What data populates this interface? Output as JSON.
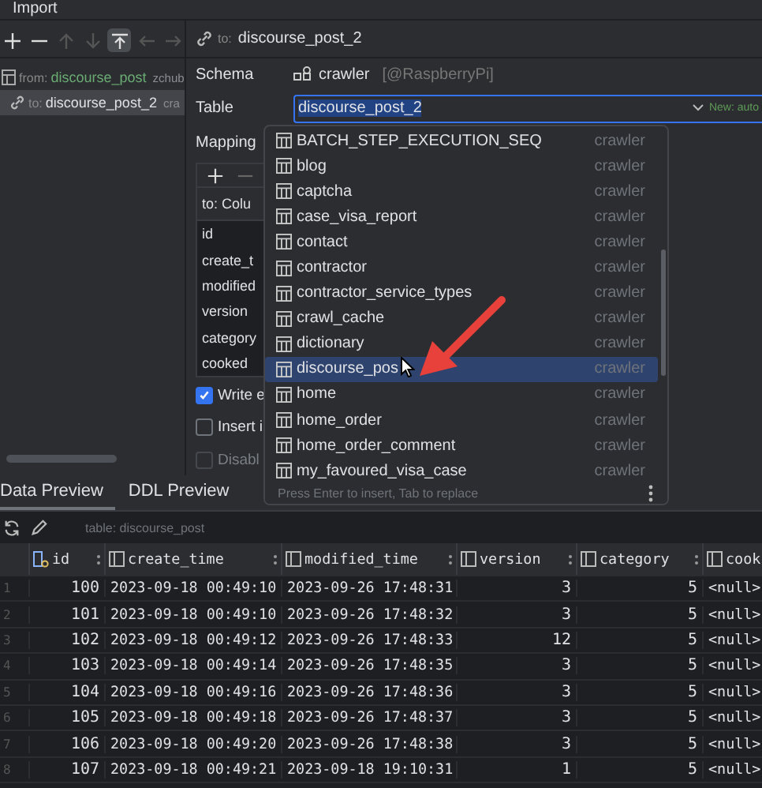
{
  "window": {
    "title": "Import"
  },
  "toolbar_buttons": [
    {
      "kind": "add",
      "disabled": false,
      "selected": false
    },
    {
      "kind": "remove",
      "disabled": false,
      "selected": false
    },
    {
      "kind": "up",
      "disabled": true,
      "selected": false
    },
    {
      "kind": "down",
      "disabled": true,
      "selected": false
    },
    {
      "kind": "pin",
      "disabled": false,
      "selected": true
    },
    {
      "kind": "back",
      "disabled": true,
      "selected": false
    },
    {
      "kind": "forward",
      "disabled": true,
      "selected": false
    }
  ],
  "sources": [
    {
      "prefix": "from:",
      "name": "discourse_post",
      "extra": "zchub",
      "selected": false,
      "children": [
        {
          "prefix": "to:",
          "name": "discourse_post_2",
          "extra": "cra",
          "selected": true
        }
      ]
    }
  ],
  "target": {
    "header_prefix": "to:",
    "header_name": "discourse_post_2",
    "schema_label": "Schema",
    "schema": "crawler",
    "schema_host": "[@RaspberryPi]",
    "table_label": "Table",
    "table_value": "discourse_post_2",
    "table_text_selected": true,
    "table_badge": "New: auto",
    "mapping_label": "Mapping",
    "mapping_header": "to: Colu",
    "mapping_rows": [
      "id",
      "create_t",
      "modified",
      "version",
      "category",
      "cooked"
    ],
    "options": [
      {
        "label": "Write e",
        "checked": true,
        "disabled": false
      },
      {
        "label": "Insert i",
        "checked": false,
        "disabled": false
      },
      {
        "label": "Disabl",
        "checked": false,
        "disabled": true
      }
    ]
  },
  "popup": {
    "items": [
      {
        "name": "BATCH_STEP_EXECUTION_SEQ",
        "schema": "crawler",
        "selected": false
      },
      {
        "name": "blog",
        "schema": "crawler",
        "selected": false
      },
      {
        "name": "captcha",
        "schema": "crawler",
        "selected": false
      },
      {
        "name": "case_visa_report",
        "schema": "crawler",
        "selected": false
      },
      {
        "name": "contact",
        "schema": "crawler",
        "selected": false
      },
      {
        "name": "contractor",
        "schema": "crawler",
        "selected": false
      },
      {
        "name": "contractor_service_types",
        "schema": "crawler",
        "selected": false
      },
      {
        "name": "crawl_cache",
        "schema": "crawler",
        "selected": false
      },
      {
        "name": "dictionary",
        "schema": "crawler",
        "selected": false
      },
      {
        "name": "discourse_pos",
        "schema": "crawler",
        "selected": true
      },
      {
        "name": "home",
        "schema": "crawler",
        "selected": false
      },
      {
        "name": "home_order",
        "schema": "crawler",
        "selected": false
      },
      {
        "name": "home_order_comment",
        "schema": "crawler",
        "selected": false
      },
      {
        "name": "my_favoured_visa_case",
        "schema": "crawler",
        "selected": false
      }
    ],
    "hint": "Press Enter to insert, Tab to replace"
  },
  "preview": {
    "tabs": [
      {
        "label": "Data Preview",
        "selected": true
      },
      {
        "label": "DDL Preview",
        "selected": false
      }
    ],
    "caption": "table: discourse_post",
    "columns": [
      {
        "name": "id",
        "kind": "key"
      },
      {
        "name": "create_time",
        "kind": "datetime"
      },
      {
        "name": "modified_time",
        "kind": "datetime"
      },
      {
        "name": "version",
        "kind": "number"
      },
      {
        "name": "category",
        "kind": "number"
      },
      {
        "name": "cook",
        "kind": "text"
      }
    ],
    "rows": [
      {
        "num": "1",
        "cells": [
          "100",
          "2023-09-18 00:49:10",
          "2023-09-26 17:48:31",
          "3",
          "5",
          "<null>"
        ]
      },
      {
        "num": "2",
        "cells": [
          "101",
          "2023-09-18 00:49:10",
          "2023-09-26 17:48:32",
          "3",
          "5",
          "<null>"
        ]
      },
      {
        "num": "3",
        "cells": [
          "102",
          "2023-09-18 00:49:12",
          "2023-09-26 17:48:33",
          "12",
          "5",
          "<null>"
        ]
      },
      {
        "num": "4",
        "cells": [
          "103",
          "2023-09-18 00:49:14",
          "2023-09-26 17:48:35",
          "3",
          "5",
          "<null>"
        ]
      },
      {
        "num": "5",
        "cells": [
          "104",
          "2023-09-18 00:49:16",
          "2023-09-26 17:48:36",
          "3",
          "5",
          "<null>"
        ]
      },
      {
        "num": "6",
        "cells": [
          "105",
          "2023-09-18 00:49:18",
          "2023-09-26 17:48:37",
          "3",
          "5",
          "<null>"
        ]
      },
      {
        "num": "7",
        "cells": [
          "106",
          "2023-09-18 00:49:20",
          "2023-09-26 17:48:38",
          "3",
          "5",
          "<null>"
        ]
      },
      {
        "num": "8",
        "cells": [
          "107",
          "2023-09-18 00:49:21",
          "2023-09-18 19:10:31",
          "1",
          "5",
          "<null>"
        ]
      }
    ]
  }
}
